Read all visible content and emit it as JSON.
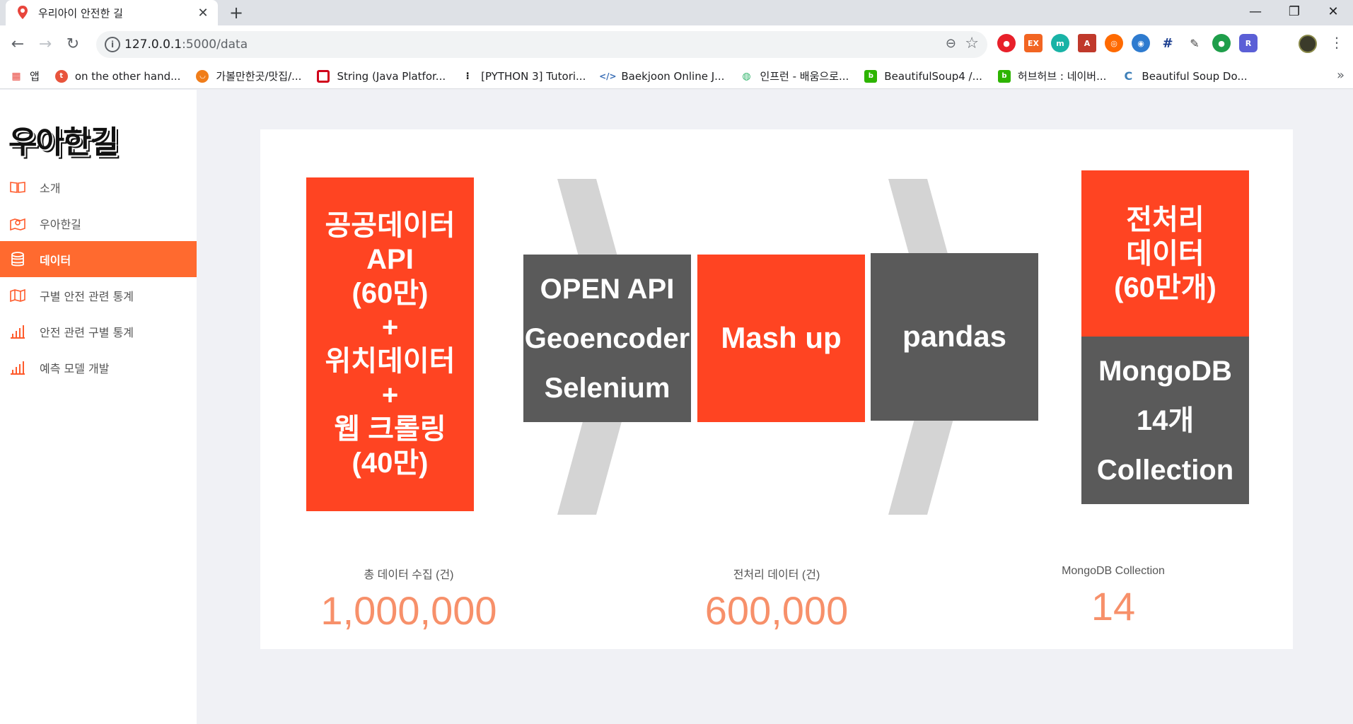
{
  "browser": {
    "tab_title": "우리아이 안전한 길",
    "url_host": "127.0.0.1",
    "url_path": ":5000/data",
    "bookmarks": [
      {
        "label": "앱",
        "color": "#e8453c"
      },
      {
        "label": "on the other hand...",
        "color": "#e8543c"
      },
      {
        "label": "가볼만한곳/맛집/...",
        "color": "#f07d1a"
      },
      {
        "label": "String (Java Platfor...",
        "color": "#d0021b"
      },
      {
        "label": "[PYTHON 3] Tutori...",
        "color": "#222222"
      },
      {
        "label": "Baekjoon Online J...",
        "color": "#3b6fb6"
      },
      {
        "label": "인프런 - 배움으로...",
        "color": "#32b56c"
      },
      {
        "label": "BeautifulSoup4 /...",
        "color": "#2db400"
      },
      {
        "label": "허브허브 : 네이버...",
        "color": "#2db400"
      },
      {
        "label": "Beautiful Soup Do...",
        "color": "#3d7fb8"
      }
    ]
  },
  "sidebar": {
    "logo": "우아한길",
    "items": [
      {
        "label": "소개",
        "icon": "book-icon"
      },
      {
        "label": "우아한길",
        "icon": "map-pin-icon"
      },
      {
        "label": "데이터",
        "icon": "database-icon"
      },
      {
        "label": "구별 안전 관련 통계",
        "icon": "map-icon"
      },
      {
        "label": "안전 관련 구별 통계",
        "icon": "bar-chart-icon"
      },
      {
        "label": "예측 모델 개발",
        "icon": "bar-chart-icon"
      }
    ],
    "active_index": 2
  },
  "pipeline": {
    "source": [
      "공공데이터",
      "API",
      "(60만)",
      "+",
      "위치데이터",
      "+",
      "웹 크롤링",
      "(40만)"
    ],
    "tools": [
      "OPEN API",
      "Geoencoder",
      "Selenium"
    ],
    "mashup": "Mash up",
    "pandas": "pandas",
    "result_top": [
      "전처리",
      "데이터",
      "(60만개)"
    ],
    "result_bottom": [
      "MongoDB",
      "14개",
      "Collection"
    ]
  },
  "stats": [
    {
      "label": "총 데이터 수집 (건)",
      "value": "1,000,000"
    },
    {
      "label": "전처리 데이터 (건)",
      "value": "600,000"
    },
    {
      "label": "MongoDB Collection",
      "value": "14"
    }
  ],
  "colors": {
    "accent": "#ff6a2f",
    "box_red": "#ff4422",
    "box_gray": "#5a5a5a",
    "stat_number": "#f7906a"
  }
}
